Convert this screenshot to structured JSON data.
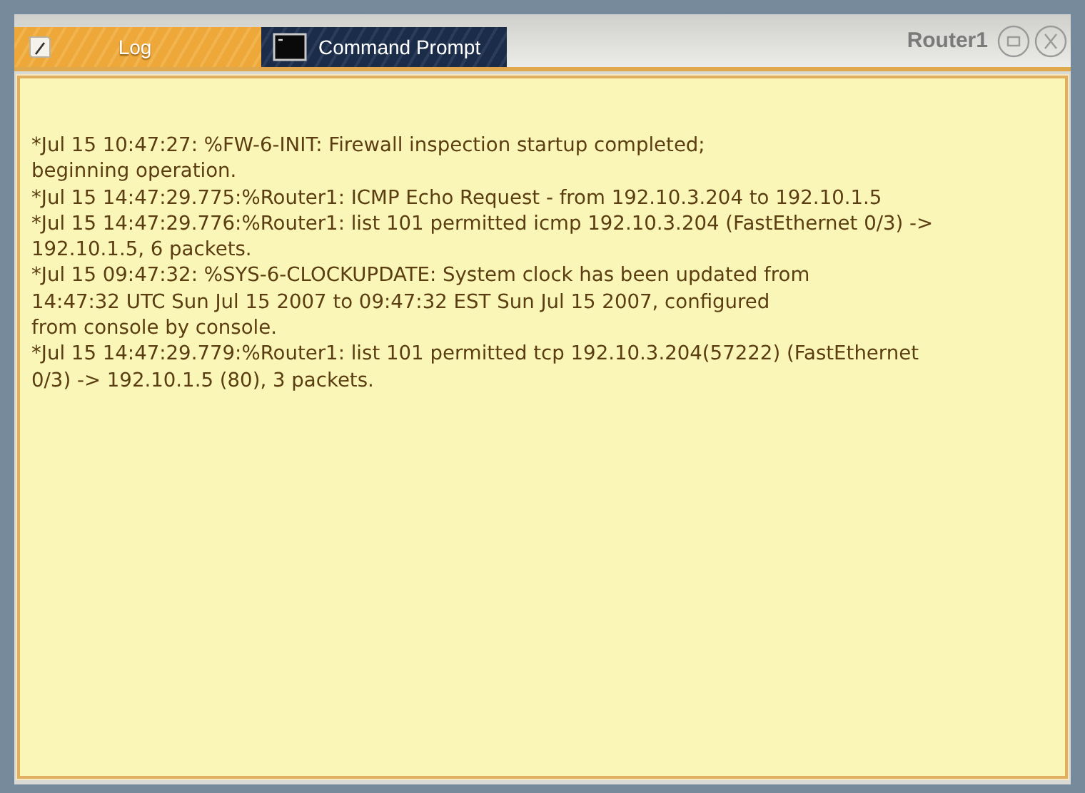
{
  "window": {
    "title": "Router1"
  },
  "tabs": [
    {
      "label": "Log",
      "kind": "log",
      "selected": true
    },
    {
      "label": "Command Prompt",
      "kind": "terminal",
      "selected": false
    }
  ],
  "log_lines": [
    "*Jul 15 10:47:27: %FW-6-INIT: Firewall inspection startup completed;",
    "beginning operation.",
    "*Jul 15 14:47:29.775:%Router1: ICMP Echo Request - from 192.10.3.204 to 192.10.1.5",
    "*Jul 15 14:47:29.776:%Router1: list 101 permitted icmp 192.10.3.204 (FastEthernet 0/3) ->",
    "192.10.1.5, 6 packets.",
    "*Jul 15 09:47:32: %SYS-6-CLOCKUPDATE: System clock has been updated from",
    "14:47:32 UTC Sun Jul 15 2007 to 09:47:32 EST Sun Jul 15 2007, configured",
    "from console by console.",
    "*Jul 15 14:47:29.779:%Router1: list 101 permitted tcp 192.10.3.204(57222) (FastEthernet",
    "0/3) -> 192.10.1.5 (80), 3 packets."
  ]
}
